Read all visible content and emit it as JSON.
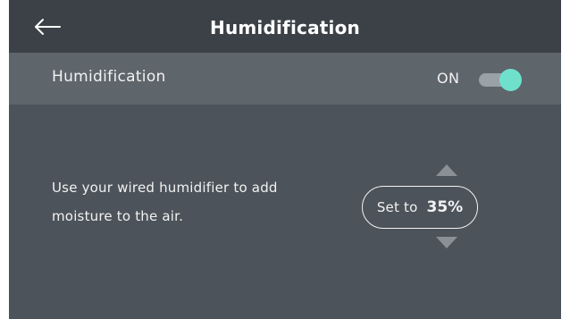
{
  "header": {
    "title": "Humidification",
    "back_icon": "arrow-left-icon"
  },
  "humidification_row": {
    "label": "Humidification",
    "state_label": "ON",
    "enabled": true
  },
  "description": "Use your wired humidifier to add moisture to the air.",
  "setpoint": {
    "prefix": "Set to",
    "value": "35%",
    "up_icon": "triangle-up-icon",
    "down_icon": "triangle-down-icon"
  },
  "colors": {
    "screen_background": "#4c535a",
    "header_background": "#3c4147",
    "row_background": "#5e656b",
    "toggle_accent": "#6fe0cc",
    "toggle_track": "#9aa1a7",
    "arrow_color": "#8a9096",
    "text": "#f2f2f2"
  }
}
